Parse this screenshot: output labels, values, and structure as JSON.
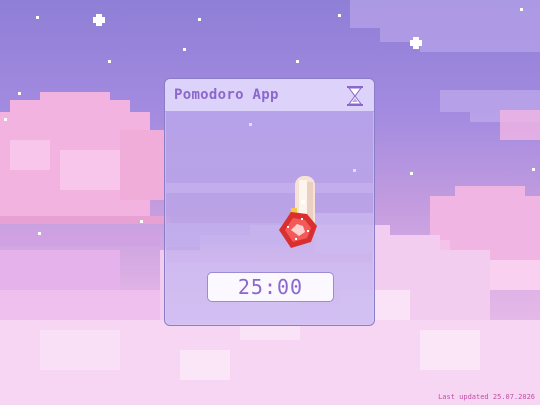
{
  "window": {
    "title": "Pomodoro App",
    "timer_display": "25:00"
  },
  "footer": {
    "last_updated": "Last updated 25.07.2026"
  },
  "icons": {
    "title_action": "hourglass-icon",
    "sprite": "strawberry-dessert-icon"
  },
  "colors": {
    "accent": "#8a68cc",
    "titlebar": "#dcd2fa",
    "footer_text": "#c24fa6"
  }
}
